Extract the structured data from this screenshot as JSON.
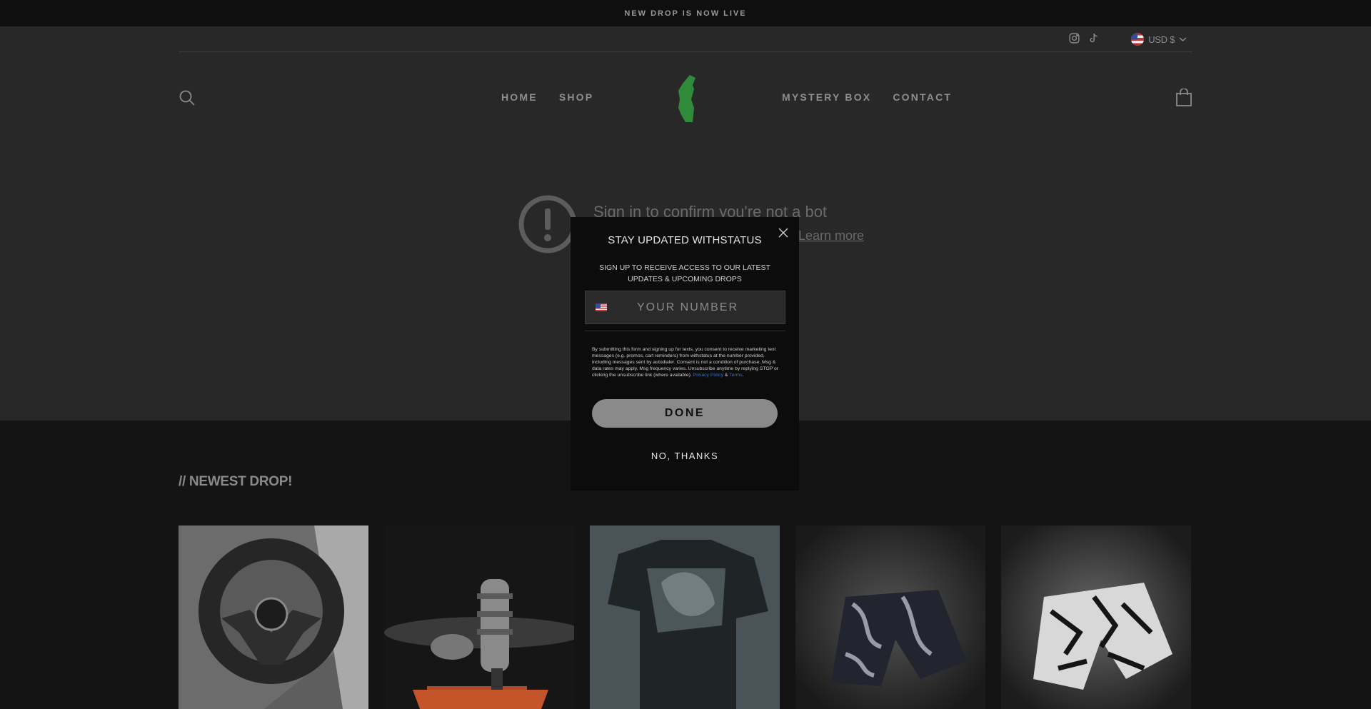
{
  "announcement": {
    "text": "NEW DROP IS NOW LIVE"
  },
  "utility_bar": {
    "social_icons": [
      "instagram-icon",
      "tiktok-icon"
    ],
    "currency": "USD $"
  },
  "header": {
    "nav_left": [
      {
        "label": "HOME"
      },
      {
        "label": "SHOP"
      }
    ],
    "nav_right": [
      {
        "label": "MYSTERY BOX"
      },
      {
        "label": "CONTACT"
      }
    ],
    "logo_color": "#2f8a3a"
  },
  "bot_notice": {
    "title": "Sign in to confirm you're not a bot",
    "link": "Learn more"
  },
  "newest_drop": {
    "title": "// NEWEST DROP!"
  },
  "popup": {
    "title": "STAY UPDATED WITHSTATUS",
    "subtitle": "SIGN UP TO RECEIVE ACCESS TO OUR LATEST UPDATES & UPCOMING DROPS",
    "phone_placeholder": "YOUR NUMBER",
    "legal_text": "By submitting this form and signing up for texts, you consent to receive marketing text messages (e.g. promos, cart reminders) from withstatus at the number provided, including messages sent by autodialer. Consent is not a condition of purchase. Msg & data rates may apply. Msg frequency varies. Unsubscribe anytime by replying STOP or clicking the unsubscribe link (where available). ",
    "privacy_label": "Privacy Policy",
    "amp": " & ",
    "terms_label": "Terms",
    "period": ".",
    "done_label": "DONE",
    "no_thanks_label": "NO, THANKS"
  }
}
